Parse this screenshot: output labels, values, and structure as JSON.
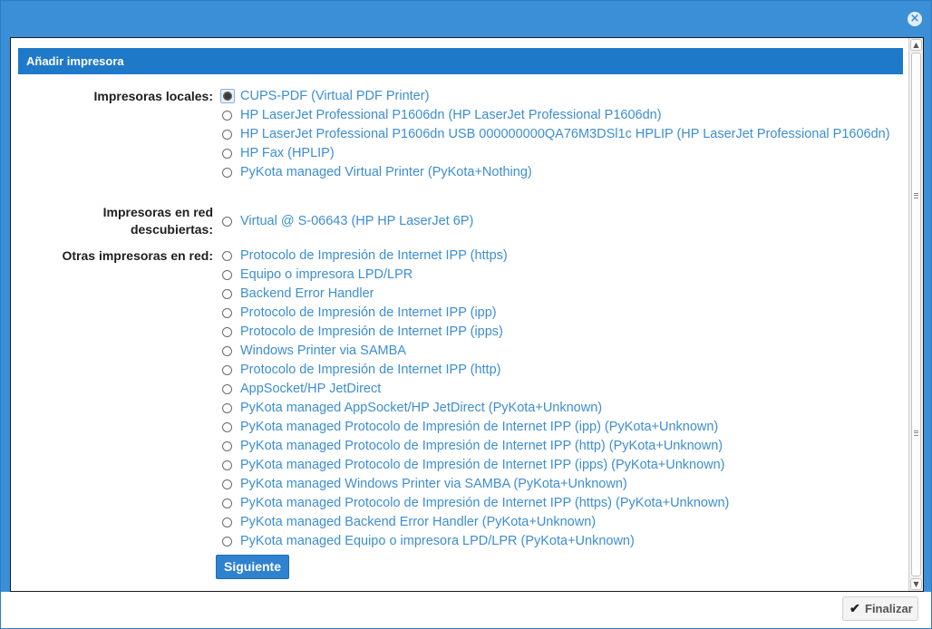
{
  "dialog": {
    "close_icon": "×",
    "section_title": "Añadir impresora",
    "local": {
      "label": "Impresoras locales:",
      "options": [
        "CUPS-PDF (Virtual PDF Printer)",
        "HP LaserJet Professional P1606dn (HP LaserJet Professional P1606dn)",
        "HP LaserJet Professional P1606dn USB 000000000QA76M3DSl1c HPLIP (HP LaserJet Professional P1606dn)",
        "HP Fax (HPLIP)",
        "PyKota managed Virtual Printer (PyKota+Nothing)"
      ],
      "selected_index": 0
    },
    "discovered": {
      "label_line1": "Impresoras en red",
      "label_line2": "descubiertas:",
      "options": [
        "Virtual @ S-06643 (HP HP LaserJet 6P)"
      ]
    },
    "other": {
      "label": "Otras impresoras en red:",
      "options": [
        "Protocolo de Impresión de Internet IPP (https)",
        "Equipo o impresora LPD/LPR",
        "Backend Error Handler",
        "Protocolo de Impresión de Internet IPP (ipp)",
        "Protocolo de Impresión de Internet IPP (ipps)",
        "Windows Printer via SAMBA",
        "Protocolo de Impresión de Internet IPP (http)",
        "AppSocket/HP JetDirect",
        "PyKota managed AppSocket/HP JetDirect (PyKota+Unknown)",
        "PyKota managed Protocolo de Impresión de Internet IPP (ipp) (PyKota+Unknown)",
        "PyKota managed Protocolo de Impresión de Internet IPP (http) (PyKota+Unknown)",
        "PyKota managed Protocolo de Impresión de Internet IPP (ipps) (PyKota+Unknown)",
        "PyKota managed Windows Printer via SAMBA (PyKota+Unknown)",
        "PyKota managed Protocolo de Impresión de Internet IPP (https) (PyKota+Unknown)",
        "PyKota managed Backend Error Handler (PyKota+Unknown)",
        "PyKota managed Equipo o impresora LPD/LPR (PyKota+Unknown)"
      ]
    },
    "next_label": "Siguiente",
    "finish_label": "Finalizar",
    "finish_icon": "check-icon"
  },
  "colors": {
    "titlebar": "#3a8fd6",
    "header": "#1f79c9",
    "link": "#3d8ed1",
    "button": "#2e82cf"
  }
}
